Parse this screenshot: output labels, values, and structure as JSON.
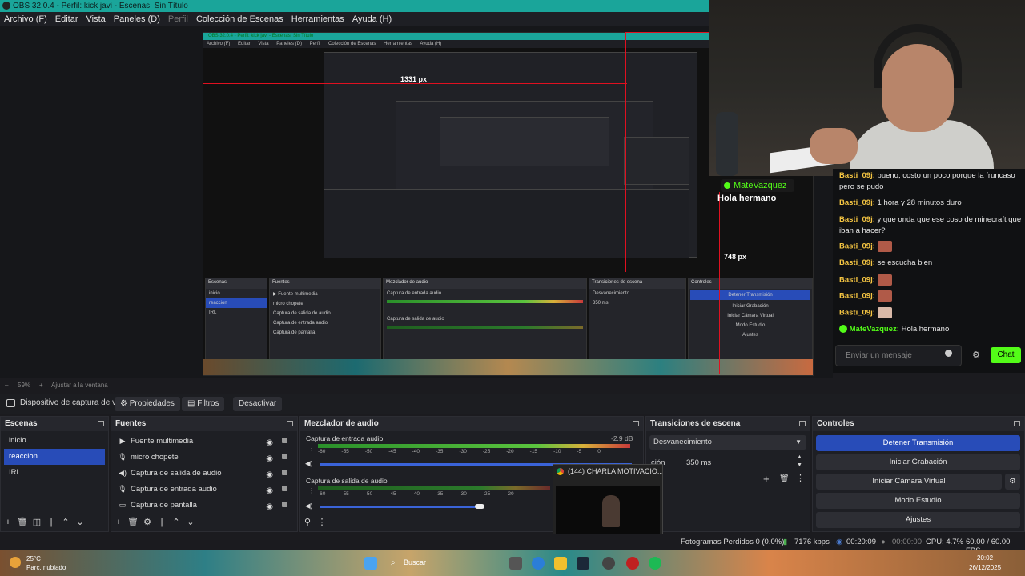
{
  "window": {
    "title": "OBS 32.0.4 - Perfil: kick javi - Escenas: Sin Título",
    "menu": [
      "Archivo (F)",
      "Editar",
      "Vista",
      "Paneles (D)",
      "Perfil",
      "Colección de Escenas",
      "Herramientas",
      "Ayuda (H)"
    ]
  },
  "preview": {
    "nested_title": "OBS 32.0.4 - Perfil: kick javi - Escenas: Sin Título",
    "nested_menu": [
      "Archivo (F)",
      "Editar",
      "Vista",
      "Paneles (D)",
      "Perfil",
      "Colección de Escenas",
      "Herramientas",
      "Ayuda (H)"
    ],
    "measure_horizontal": "1331 px",
    "measure_vertical": "748 px"
  },
  "overlay": {
    "username": "MateVazquez",
    "message": "Hola hermano"
  },
  "chat": {
    "messages": [
      {
        "user": "Basti_09j:",
        "text": "bueno, costo un poco porque la fruncaso pero se pudo"
      },
      {
        "user": "Basti_09j:",
        "text": "1 hora y 28 minutos duro"
      },
      {
        "user": "Basti_09j:",
        "text": "y que onda que ese coso de minecraft que iban a hacer?"
      },
      {
        "user": "Basti_09j:",
        "text": ""
      },
      {
        "user": "Basti_09j:",
        "text": "se escucha bien"
      },
      {
        "user": "Basti_09j:",
        "text": ""
      },
      {
        "user": "Basti_09j:",
        "text": ""
      },
      {
        "user": "Basti_09j:",
        "text": ""
      },
      {
        "user": "MateVazquez:",
        "text": "Hola hermano"
      }
    ],
    "input_placeholder": "Enviar un mensaje",
    "send_label": "Chat"
  },
  "zoom": {
    "value": "59%",
    "fit_label": "Ajustar a la ventana"
  },
  "source_toolbar": {
    "source_name": "Dispositivo de captura de v",
    "properties": "Propiedades",
    "filters": "Filtros",
    "deactivate": "Desactivar"
  },
  "scenes": {
    "title": "Escenas",
    "items": [
      "inicio",
      "reaccion",
      "IRL"
    ],
    "selected": "reaccion"
  },
  "sources": {
    "title": "Fuentes",
    "items": [
      {
        "icon": "play-icon",
        "label": "Fuente multimedia"
      },
      {
        "icon": "microphone-icon",
        "label": "micro chopete"
      },
      {
        "icon": "speaker-icon",
        "label": "Captura de salida de audio"
      },
      {
        "icon": "microphone-icon",
        "label": "Captura de entrada audio"
      },
      {
        "icon": "monitor-icon",
        "label": "Captura de pantalla"
      }
    ]
  },
  "mixer": {
    "title": "Mezclador de audio",
    "channels": [
      {
        "name": "Captura de entrada audio",
        "db": "-2.9 dB"
      },
      {
        "name": "Captura de salida de audio",
        "db": ""
      }
    ],
    "ticks": [
      "-60",
      "-55",
      "-50",
      "-45",
      "-40",
      "-35",
      "-30",
      "-25",
      "-20",
      "-15",
      "-10",
      "-5",
      "0"
    ]
  },
  "transitions": {
    "title": "Transiciones de escena",
    "selected": "Desvanecimiento",
    "duration_label": "ción",
    "duration_value": "350 ms"
  },
  "controls": {
    "title": "Controles",
    "buttons": [
      "Detener Transmisión",
      "Iniciar Grabación",
      "Iniciar Cámara Virtual",
      "Modo Estudio",
      "Ajustes"
    ]
  },
  "tooltip": {
    "title": "(144) CHARLA MOTIVACIO..."
  },
  "status": {
    "dropped": "Fotogramas Perdidos 0 (0.0%)",
    "bitrate": "7176 kbps",
    "stream_time": "00:20:09",
    "rec_time": "00:00:00",
    "cpu": "CPU: 4.7%",
    "fps": "60.00 / 60.00 FPS"
  },
  "taskbar": {
    "weather_temp": "25°C",
    "weather_desc": "Parc. nublado",
    "search": "Buscar",
    "time": "20:02",
    "date": "26/12/2025"
  },
  "colors": {
    "accent_blue": "#284cb8",
    "kick_green": "#53fc18",
    "title_teal": "#1aa59a",
    "measure_red": "#e01020"
  }
}
